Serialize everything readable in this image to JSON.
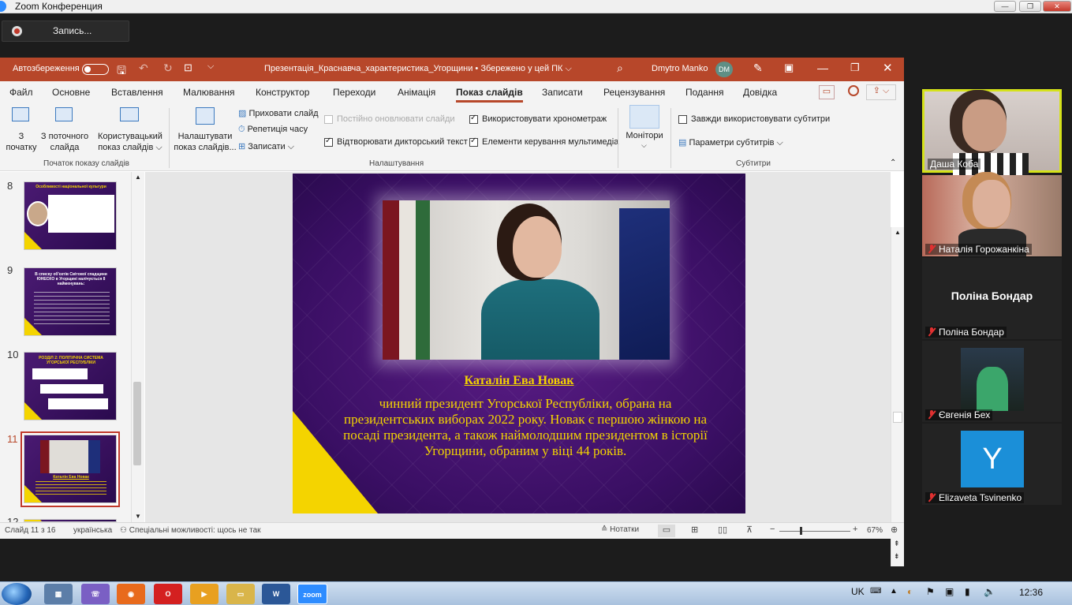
{
  "zoom": {
    "title": "Zoom Конференция",
    "record_label": "Запись...",
    "window_buttons": {
      "minimize": "—",
      "maximize": "❐",
      "close": "✕"
    }
  },
  "ppt": {
    "autosave_label": "Автозбереження",
    "doc_title": "Презентація_Краснавча_характеристика_Угорщини • Збережено у цей ПК ⌵",
    "user_name": "Dmytro Manko",
    "user_initials": "DM",
    "tabs": [
      "Файл",
      "Основне",
      "Вставлення",
      "Малювання",
      "Конструктор",
      "Переходи",
      "Анімація",
      "Показ слайдів",
      "Записати",
      "Рецензування",
      "Подання",
      "Довідка"
    ],
    "active_tab": "Показ слайдів",
    "ribbon": {
      "from_start": "З\nпочатку",
      "from_current": "З поточного\nслайда",
      "custom_show": "Користувацький\nпоказ слайдів ⌵",
      "group_start": "Початок показу слайдів",
      "setup_show": "Налаштувати\nпоказ слайдів...",
      "hide_slide": "Приховати слайд",
      "rehearse": "Репетиція часу",
      "record": "Записати",
      "keep_updated": "Постійно оновлювати слайди",
      "play_narration": "Відтворювати дикторський текст",
      "use_timings": "Використовувати хронометраж",
      "media_controls": "Елементи керування мультимедіа",
      "group_setup": "Налаштування",
      "monitors": "Монітори",
      "always_subtitles": "Завжди використовувати субтитри",
      "subtitle_settings": "Параметри субтитрів",
      "group_subtitles": "Субтитри"
    },
    "thumbnails": [
      {
        "num": "8",
        "title": "Особливості національної культури"
      },
      {
        "num": "9",
        "title": "В списку об'єктів Світової спадщини ЮНЕСКО в Угорщині налічується 8 найменувань:"
      },
      {
        "num": "10",
        "title": "РОЗДІЛ 2: ПОЛІТИЧНА СИСТЕМА УГОРСЬКОЇ РЕСПУБЛІКИ"
      },
      {
        "num": "11",
        "title": "Каталін Ева Новак"
      },
      {
        "num": "12",
        "title": ""
      }
    ],
    "slide": {
      "name": "Каталін Ева Новак",
      "text": "чинний президент Угорської Республіки, обрана на президентських виборах 2022 року. Новак є першою жінкою на посаді президента, а також наймолодшим президентом в історії Угорщини, обраним у віці 44 років."
    },
    "status": {
      "slide_of": "Слайд 11 з 16",
      "language": "українська",
      "accessibility": "Спеціальні можливості: щось не так",
      "notes": "Нотатки",
      "zoom": "67%"
    }
  },
  "participants": [
    {
      "name": "Даша Коба",
      "muted": false,
      "active": true
    },
    {
      "name": "Наталія Горожанкіна",
      "muted": true
    },
    {
      "name": "Поліна Бондар",
      "muted": true,
      "center_text": "Поліна Бондар"
    },
    {
      "name": "Євгенія Бех",
      "muted": true
    },
    {
      "name": "Elizaveta Tsvinenko",
      "muted": true,
      "initial": "Y"
    }
  ],
  "taskbar": {
    "language": "UK",
    "time": "12:36"
  }
}
